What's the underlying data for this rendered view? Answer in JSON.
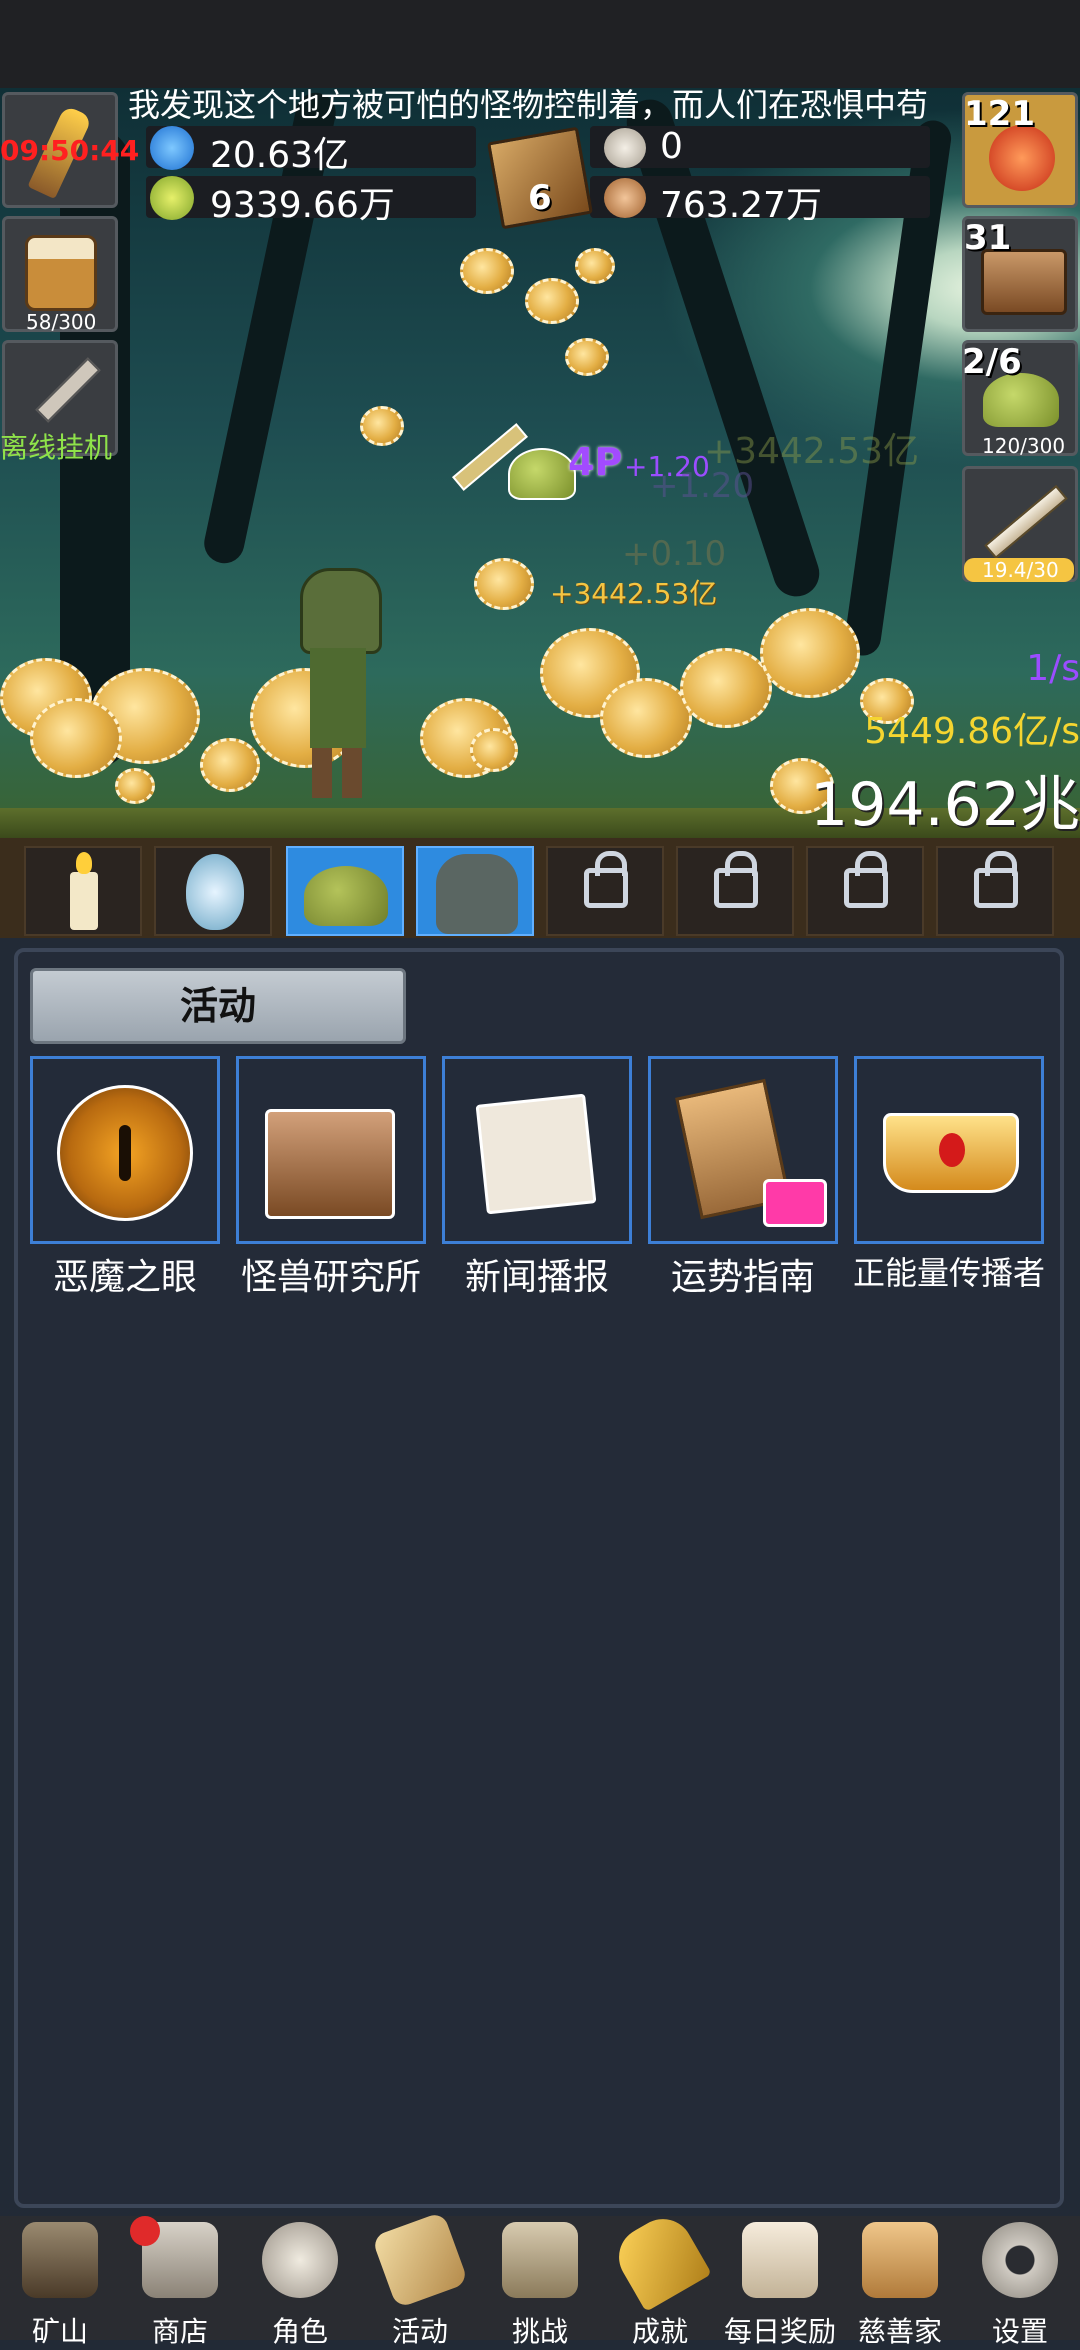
{
  "story_text": "我发现这个地方被可怕的怪物控制着，而人们在恐惧中苟",
  "timer": "09:50:44",
  "resources": {
    "blue_potion": "20.63亿",
    "green_potion": "9339.66万",
    "book_count": "6",
    "silver_coin": "0",
    "bronze_shell": "763.27万"
  },
  "left_slots": {
    "beer_progress": "58/300",
    "offline_label": "离线挂机"
  },
  "right_slots": {
    "potion_count": "121",
    "chest_count": "31",
    "slime_count": "2/6",
    "slime_progress": "120/300",
    "sword_progress": "19.4/30"
  },
  "battle": {
    "float_gain_1": "+3442.53亿",
    "float_gain_2": "+3442.53亿",
    "float_purple": "+1.20",
    "float_purple_faded": "+1.20",
    "float_faded": "+0.10",
    "float_hp": "4P",
    "rate_purple": "1/s",
    "rate_gold": "5449.86亿/s",
    "total": "194.62兆"
  },
  "pet_bar": [
    {
      "name": "candle",
      "locked": false,
      "active": false
    },
    {
      "name": "egg",
      "locked": false,
      "active": false
    },
    {
      "name": "slime",
      "locked": false,
      "active": true
    },
    {
      "name": "zombie",
      "locked": false,
      "active": true
    },
    {
      "name": "locked-1",
      "locked": true,
      "active": false
    },
    {
      "name": "locked-2",
      "locked": true,
      "active": false
    },
    {
      "name": "locked-3",
      "locked": true,
      "active": false
    },
    {
      "name": "locked-4",
      "locked": true,
      "active": false
    }
  ],
  "panel": {
    "tab_label": "活动",
    "activities": [
      {
        "label": "恶魔之眼",
        "icon": "demon-eye-icon"
      },
      {
        "label": "怪兽研究所",
        "icon": "monster-lab-icon"
      },
      {
        "label": "新闻播报",
        "icon": "news-icon"
      },
      {
        "label": "运势指南",
        "icon": "fortune-icon"
      },
      {
        "label": "正能量传播者",
        "icon": "crown-icon"
      }
    ]
  },
  "bottom_nav": [
    {
      "label": "矿山",
      "icon": "lantern-icon"
    },
    {
      "label": "商店",
      "icon": "shop-icon"
    },
    {
      "label": "角色",
      "icon": "skull-icon"
    },
    {
      "label": "活动",
      "icon": "scroll-icon"
    },
    {
      "label": "挑战",
      "icon": "map-icon"
    },
    {
      "label": "成就",
      "icon": "key-icon"
    },
    {
      "label": "每日奖励",
      "icon": "letter-icon"
    },
    {
      "label": "慈善家",
      "icon": "bread-icon"
    },
    {
      "label": "设置",
      "icon": "gear-icon"
    }
  ],
  "colors": {
    "panel_bg": "#242b38",
    "card_border": "#3d7fd6",
    "active_pet": "#2e8be0",
    "timer_red": "#ff2020",
    "gold_text": "#f5c542",
    "purple_text": "#9b4dff",
    "offline_green": "#8fe34a"
  }
}
